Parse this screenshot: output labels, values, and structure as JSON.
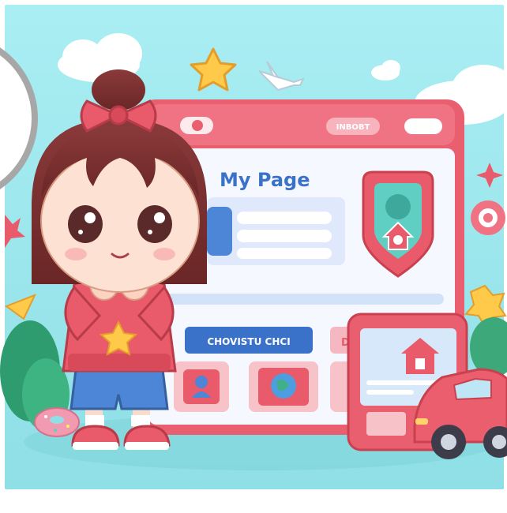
{
  "window": {
    "title": "My Page",
    "header_button_label": "INBOBT"
  },
  "section": {
    "label": "CHOVISTU CHCI",
    "tab_partial": "D"
  },
  "colors": {
    "sky": "#9ee8ef",
    "window_frame": "#ef6a78",
    "window_body": "#f6f8ff",
    "accent_blue": "#3b72c9",
    "shield": "#e95a6a"
  },
  "icons": {
    "header": [
      "toggle-pill-icon",
      "pill-button-icon"
    ],
    "profile": "avatar-placeholder-icon",
    "shield": "home-shield-icon",
    "cards": [
      "user-icon",
      "globe-icon"
    ],
    "tablet": "house-icon",
    "decor": [
      "star-icon",
      "airplane-icon",
      "cloud-icon",
      "donut-icon",
      "car-icon"
    ]
  }
}
